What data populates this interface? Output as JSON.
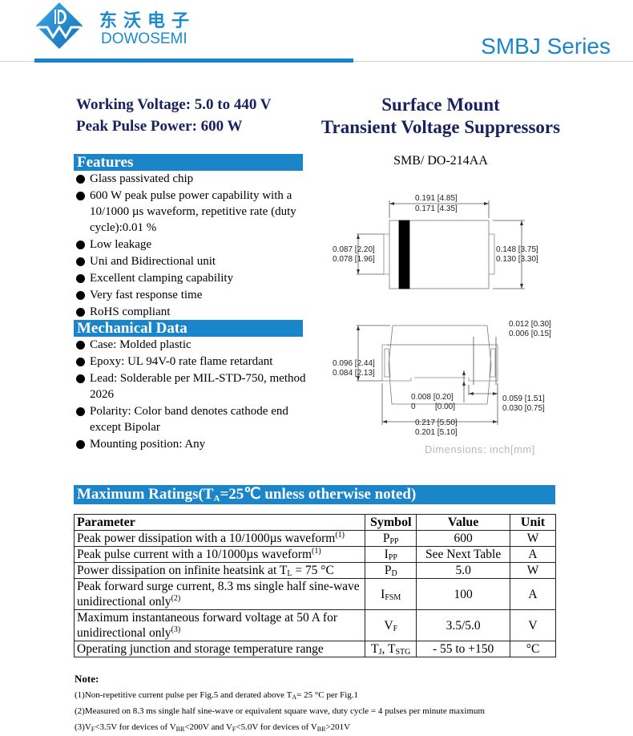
{
  "header": {
    "brand_cn": "东沃电子",
    "brand_en": "DOWOSEMI",
    "logo_icon": "dw-diamond-logo-icon",
    "series": "SMBJ Series",
    "colors": {
      "brand_blue": "#1b85c9",
      "navy": "#1a2161"
    }
  },
  "specs": {
    "working_voltage": "Working Voltage: 5.0 to 440 V",
    "peak_pulse_power": "Peak Pulse Power: 600 W"
  },
  "title": {
    "line1": "Surface Mount",
    "line2": "Transient Voltage Suppressors",
    "package": "SMB/ DO-214AA"
  },
  "features": {
    "heading": "Features",
    "items": [
      "Glass passivated chip",
      "600 W peak pulse power capability with a 10/1000 µs waveform, repetitive rate (duty cycle):0.01 %",
      "Low leakage",
      "Uni and Bidirectional unit",
      "Excellent clamping capability",
      "Very fast response time",
      "RoHS compliant"
    ]
  },
  "mechanical": {
    "heading": "Mechanical Data",
    "items": [
      "Case: Molded plastic",
      "Epoxy: UL 94V-0 rate flame retardant",
      "Lead: Solderable per MIL-STD-750, method 2026",
      "Polarity: Color band denotes cathode end except Bipolar",
      "Mounting position: Any"
    ]
  },
  "drawing": {
    "top_view": {
      "width_max": "0.191 [4.85]",
      "width_min": "0.171 [4.35]",
      "lead_max": "0.087 [2.20]",
      "lead_min": "0.078 [1.96]",
      "height_max": "0.148 [3.75]",
      "height_min": "0.130 [3.30]"
    },
    "side_view": {
      "lead_thk_max": "0.012 [0.30]",
      "lead_thk_min": "0.006 [0.15]",
      "body_h_max": "0.096 [2.44]",
      "body_h_min": "0.084 [2.13]",
      "standoff_max": "0.008 [0.20]",
      "standoff_min_in": "0",
      "standoff_min_mm": "[0.00]",
      "lead_len_max": "0.059 [1.51]",
      "lead_len_min": "0.030 [0.75]",
      "total_max": "0.217 [5.50]",
      "total_min": "0.201 [5.10]"
    },
    "units_note": "Dimensions: inch[mm]"
  },
  "ratings": {
    "heading_pre": "Maximum Ratings(T",
    "heading_sub": "A",
    "heading_post": "=25℃  unless otherwise noted)",
    "columns": [
      "Parameter",
      "Symbol",
      "Value",
      "Unit"
    ],
    "rows": [
      {
        "param": "Peak power dissipation with a 10/1000µs waveform",
        "param_sup": "(1)",
        "sym": "P",
        "sym_sub": "PP",
        "sym2": "",
        "sym2_sub": "",
        "value": "600",
        "unit": "W"
      },
      {
        "param": "Peak pulse current with a 10/1000µs waveform",
        "param_sup": "(1)",
        "sym": "I",
        "sym_sub": "PP",
        "sym2": "",
        "sym2_sub": "",
        "value": "See Next Table",
        "unit": "A"
      },
      {
        "param": "Power dissipation on infinite heatsink at T",
        "param_sub": "L",
        "param_post": " = 75 °C",
        "sym": "P",
        "sym_sub": "D",
        "value": "5.0",
        "unit": "W"
      },
      {
        "param": "Peak forward surge current, 8.3 ms single half sine-wave unidirectional only",
        "param_sup": "(2)",
        "sym": "I",
        "sym_sub": "FSM",
        "value": "100",
        "unit": "A"
      },
      {
        "param": "Maximum instantaneous forward voltage at 50 A for unidirectional only",
        "param_sup": "(3)",
        "sym": "V",
        "sym_sub": "F",
        "value": "3.5/5.0",
        "unit": "V"
      },
      {
        "param": "Operating junction and storage temperature range",
        "sym": "T",
        "sym_sub": "J",
        "sym_mid": ", T",
        "sym2_sub": "STG",
        "value": "- 55 to +150",
        "unit": "°C"
      }
    ]
  },
  "notes": {
    "title": "Note:",
    "n1_pre": "(1)Non-repetitive current pulse per Fig.5 and derated above T",
    "n1_sub": "A",
    "n1_post": "= 25 °C per Fig.1",
    "n2": "(2)Measured on 8.3 ms single half sine-wave or equivalent square wave, duty cycle = 4 pulses per minute maximum",
    "n3_a": "(3)V",
    "n3_a_sub": "F",
    "n3_b": "<3.5V for devices of V",
    "n3_b_sub": "BR",
    "n3_c": "<200V and V",
    "n3_c_sub": "F",
    "n3_d": "<5.0V for devices of V",
    "n3_d_sub": "BR",
    "n3_e": ">201V"
  }
}
